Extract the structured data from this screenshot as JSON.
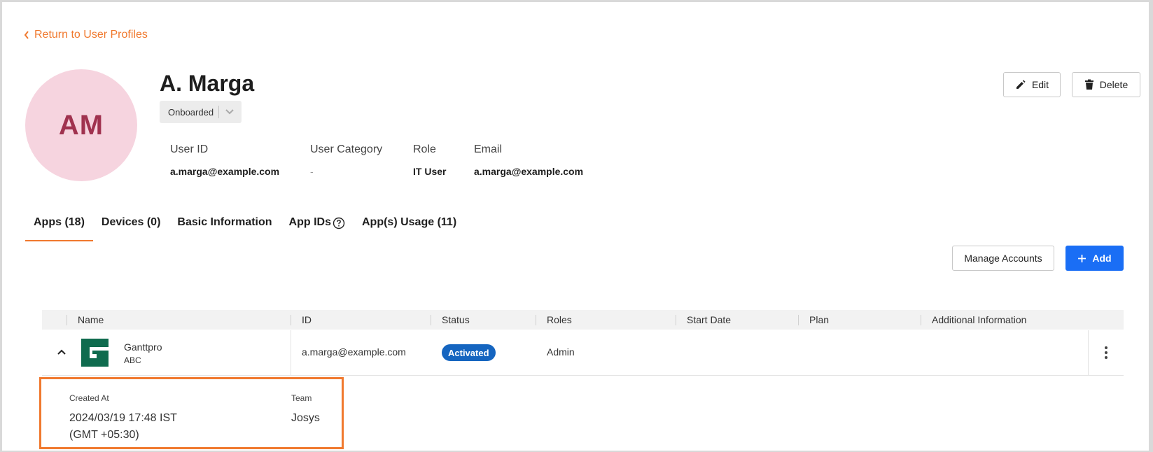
{
  "back_link": {
    "label": "Return to User Profiles"
  },
  "profile": {
    "initials": "AM",
    "name": "A. Marga",
    "status": "Onboarded",
    "fields": [
      {
        "label": "User ID",
        "value": "a.marga@example.com"
      },
      {
        "label": "User Category",
        "value": "-"
      },
      {
        "label": "Role",
        "value": "IT User"
      },
      {
        "label": "Email",
        "value": "a.marga@example.com"
      }
    ]
  },
  "actions": {
    "edit_label": "Edit",
    "delete_label": "Delete"
  },
  "tabs": [
    {
      "label": "Apps (18)",
      "active": true
    },
    {
      "label": "Devices (0)",
      "active": false
    },
    {
      "label": "Basic Information",
      "active": false
    },
    {
      "label": "App IDs",
      "active": false,
      "icon": "help-circle-icon"
    },
    {
      "label": "App(s) Usage (11)",
      "active": false
    }
  ],
  "toolbar": {
    "manage_label": "Manage Accounts",
    "add_label": "Add"
  },
  "table": {
    "columns": [
      "Name",
      "ID",
      "Status",
      "Roles",
      "Start Date",
      "Plan",
      "Additional Information"
    ],
    "rows": [
      {
        "app_name": "Ganttpro",
        "app_sub": "ABC",
        "id": "a.marga@example.com",
        "status": "Activated",
        "roles": "Admin",
        "start_date": "",
        "plan": "",
        "additional_info": "",
        "expanded": true,
        "details": {
          "created_at_label": "Created At",
          "created_at_line1": "2024/03/19 17:48 IST",
          "created_at_line2": "(GMT +05:30)",
          "team_label": "Team",
          "team_value": "Josys"
        }
      }
    ]
  },
  "colors": {
    "accent": "#f0792e",
    "primary": "#1a6ef5",
    "status_badge": "#1565c0",
    "avatar_bg": "#f6d4df",
    "avatar_text": "#a0324f",
    "app_logo": "#0f6b4e"
  }
}
